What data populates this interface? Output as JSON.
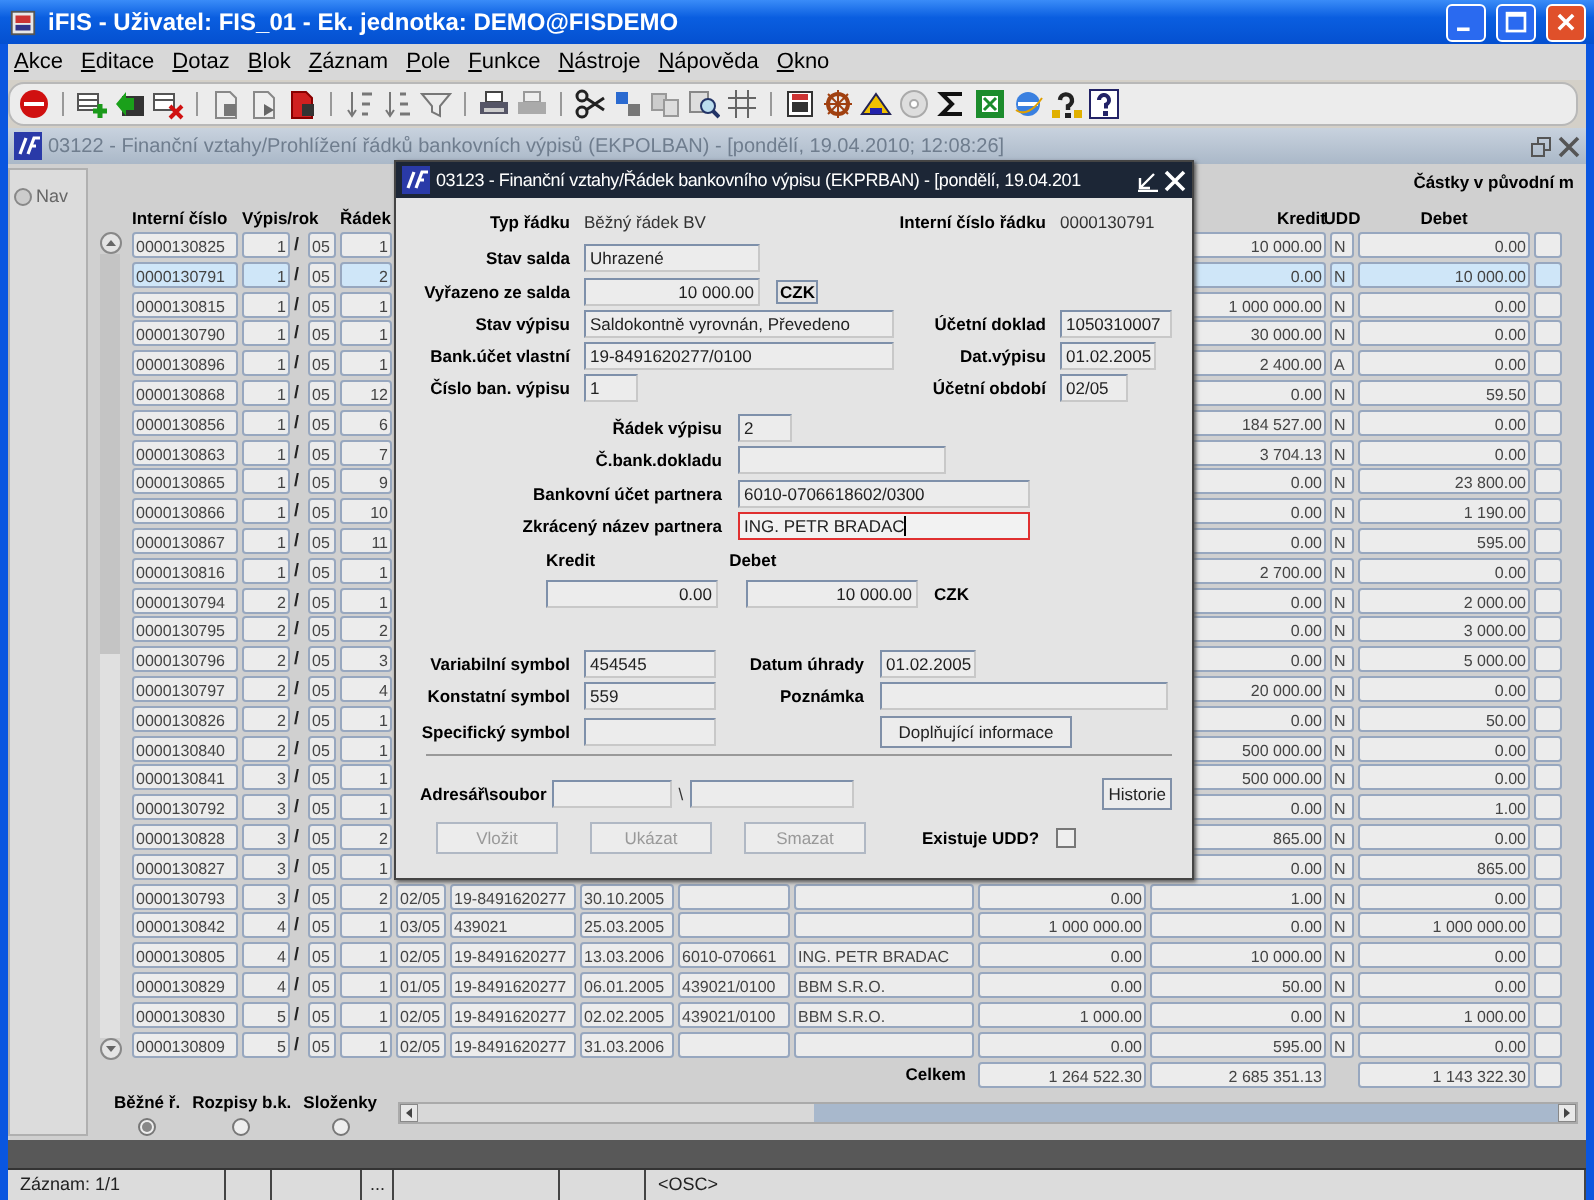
{
  "window": {
    "title": "iFIS - Uživatel: FIS_01 - Ek. jednotka: DEMO@FISDEMO"
  },
  "menu": [
    "Akce",
    "Editace",
    "Dotaz",
    "Blok",
    "Záznam",
    "Pole",
    "Funkce",
    "Nástroje",
    "Nápověda",
    "Okno"
  ],
  "inner_window": {
    "title": "03122 - Finanční vztahy/Prohlížení řádků bankovních výpisů (EKPOLBAN) - [pondělí, 19.04.2010; 12:08:26]",
    "nav_label": "Nav"
  },
  "table": {
    "group_header": "Částky v původní m",
    "columns": {
      "id": "Interní číslo",
      "vypis_rok": "Výpis/rok",
      "radek": "Řádek",
      "kredit": "Kredit",
      "udd": "UDD",
      "debet": "Debet"
    },
    "rows": [
      {
        "id": "0000130825",
        "vypis": "1",
        "sep": "/",
        "rok": "05",
        "radek": "1",
        "kredit": "10 000.00",
        "udd": "N",
        "debet": "0.00",
        "selected": false
      },
      {
        "id": "0000130791",
        "vypis": "1",
        "sep": "/",
        "rok": "05",
        "radek": "2",
        "kredit": "0.00",
        "udd": "N",
        "debet": "10 000.00",
        "selected": true
      },
      {
        "id": "0000130815",
        "vypis": "1",
        "sep": "/",
        "rok": "05",
        "radek": "1",
        "kredit": "1 000 000.00",
        "udd": "N",
        "debet": "0.00",
        "selected": false
      },
      {
        "id": "0000130790",
        "vypis": "1",
        "sep": "/",
        "rok": "05",
        "radek": "1",
        "kredit": "30 000.00",
        "udd": "N",
        "debet": "0.00",
        "selected": false
      },
      {
        "id": "0000130896",
        "vypis": "1",
        "sep": "/",
        "rok": "05",
        "radek": "1",
        "kredit": "2 400.00",
        "udd": "A",
        "debet": "0.00",
        "selected": false
      },
      {
        "id": "0000130868",
        "vypis": "1",
        "sep": "/",
        "rok": "05",
        "radek": "12",
        "kredit": "0.00",
        "udd": "N",
        "debet": "59.50",
        "selected": false
      },
      {
        "id": "0000130856",
        "vypis": "1",
        "sep": "/",
        "rok": "05",
        "radek": "6",
        "kredit": "184 527.00",
        "udd": "N",
        "debet": "0.00",
        "selected": false
      },
      {
        "id": "0000130863",
        "vypis": "1",
        "sep": "/",
        "rok": "05",
        "radek": "7",
        "kredit": "3 704.13",
        "udd": "N",
        "debet": "0.00",
        "selected": false
      },
      {
        "id": "0000130865",
        "vypis": "1",
        "sep": "/",
        "rok": "05",
        "radek": "9",
        "kredit": "0.00",
        "udd": "N",
        "debet": "23 800.00",
        "selected": false
      },
      {
        "id": "0000130866",
        "vypis": "1",
        "sep": "/",
        "rok": "05",
        "radek": "10",
        "kredit": "0.00",
        "udd": "N",
        "debet": "1 190.00",
        "selected": false
      },
      {
        "id": "0000130867",
        "vypis": "1",
        "sep": "/",
        "rok": "05",
        "radek": "11",
        "kredit": "0.00",
        "udd": "N",
        "debet": "595.00",
        "selected": false
      },
      {
        "id": "0000130816",
        "vypis": "1",
        "sep": "/",
        "rok": "05",
        "radek": "1",
        "kredit": "2 700.00",
        "udd": "N",
        "debet": "0.00",
        "selected": false
      },
      {
        "id": "0000130794",
        "vypis": "2",
        "sep": "/",
        "rok": "05",
        "radek": "1",
        "kredit": "0.00",
        "udd": "N",
        "debet": "2 000.00",
        "selected": false
      },
      {
        "id": "0000130795",
        "vypis": "2",
        "sep": "/",
        "rok": "05",
        "radek": "2",
        "kredit": "0.00",
        "udd": "N",
        "debet": "3 000.00",
        "selected": false
      },
      {
        "id": "0000130796",
        "vypis": "2",
        "sep": "/",
        "rok": "05",
        "radek": "3",
        "kredit": "0.00",
        "udd": "N",
        "debet": "5 000.00",
        "selected": false
      },
      {
        "id": "0000130797",
        "vypis": "2",
        "sep": "/",
        "rok": "05",
        "radek": "4",
        "kredit": "20 000.00",
        "udd": "N",
        "debet": "0.00",
        "selected": false
      },
      {
        "id": "0000130826",
        "vypis": "2",
        "sep": "/",
        "rok": "05",
        "radek": "1",
        "kredit": "0.00",
        "udd": "N",
        "debet": "50.00",
        "selected": false
      },
      {
        "id": "0000130840",
        "vypis": "2",
        "sep": "/",
        "rok": "05",
        "radek": "1",
        "kredit": "500 000.00",
        "udd": "N",
        "debet": "0.00",
        "selected": false
      },
      {
        "id": "0000130841",
        "vypis": "3",
        "sep": "/",
        "rok": "05",
        "radek": "1",
        "kredit": "500 000.00",
        "udd": "N",
        "debet": "0.00",
        "selected": false
      },
      {
        "id": "0000130792",
        "vypis": "3",
        "sep": "/",
        "rok": "05",
        "radek": "1",
        "kredit": "0.00",
        "udd": "N",
        "debet": "1.00",
        "selected": false
      },
      {
        "id": "0000130828",
        "vypis": "3",
        "sep": "/",
        "rok": "05",
        "radek": "2",
        "kredit": "865.00",
        "udd": "N",
        "debet": "0.00",
        "selected": false
      },
      {
        "id": "0000130827",
        "vypis": "3",
        "sep": "/",
        "rok": "05",
        "radek": "1",
        "kredit": "0.00",
        "udd": "N",
        "debet": "865.00",
        "selected": false
      },
      {
        "id": "0000130793",
        "vypis": "3",
        "sep": "/",
        "rok": "05",
        "radek": "2",
        "column_6": "02/05",
        "column_7": "19-8491620277",
        "column_8": "30.10.2005",
        "column_11": "0.00",
        "kredit": "1.00",
        "udd": "N",
        "debet": "0.00",
        "selected": false
      },
      {
        "id": "0000130842",
        "vypis": "4",
        "sep": "/",
        "rok": "05",
        "radek": "1",
        "column_6": "03/05",
        "column_7": "439021",
        "column_8": "25.03.2005",
        "column_11": "1 000 000.00",
        "kredit": "0.00",
        "udd": "N",
        "debet": "1 000 000.00",
        "selected": false
      },
      {
        "id": "0000130805",
        "vypis": "4",
        "sep": "/",
        "rok": "05",
        "radek": "1",
        "column_6": "02/05",
        "column_7": "19-8491620277",
        "column_8": "13.03.2006",
        "column_9": "6010-070661",
        "column_10": "ING. PETR BRADAC",
        "column_11": "0.00",
        "kredit": "10 000.00",
        "udd": "N",
        "debet": "0.00",
        "selected": false
      },
      {
        "id": "0000130829",
        "vypis": "4",
        "sep": "/",
        "rok": "05",
        "radek": "1",
        "column_6": "01/05",
        "column_7": "19-8491620277",
        "column_8": "06.01.2005",
        "column_9": "439021/0100",
        "column_10": "BBM S.R.O.",
        "column_11": "0.00",
        "kredit": "50.00",
        "udd": "N",
        "debet": "0.00",
        "selected": false
      },
      {
        "id": "0000130830",
        "vypis": "5",
        "sep": "/",
        "rok": "05",
        "radek": "1",
        "column_6": "02/05",
        "column_7": "19-8491620277",
        "column_8": "02.02.2005",
        "column_9": "439021/0100",
        "column_10": "BBM S.R.O.",
        "column_11": "1 000.00",
        "kredit": "0.00",
        "udd": "N",
        "debet": "1 000.00",
        "selected": false
      },
      {
        "id": "0000130809",
        "vypis": "5",
        "sep": "/",
        "rok": "05",
        "radek": "1",
        "column_6": "02/05",
        "column_7": "19-8491620277",
        "column_8": "31.03.2006",
        "column_11": "0.00",
        "kredit": "595.00",
        "udd": "N",
        "debet": "0.00",
        "selected": false
      }
    ],
    "totals": {
      "label": "Celkem",
      "column_11": "1 264 522.30",
      "kredit": "2 685 351.13",
      "debet": "1 143 322.30"
    }
  },
  "radios": [
    {
      "label": "Běžné ř.",
      "selected": true
    },
    {
      "label": "Rozpisy b.k.",
      "selected": false
    },
    {
      "label": "Složenky",
      "selected": false
    }
  ],
  "dialog": {
    "title": "03123 - Finanční vztahy/Řádek bankovního výpisu (EKPRBAN) - [pondělí, 19.04.201",
    "typ_radku": {
      "label": "Typ řádku",
      "value": "Běžný řádek BV"
    },
    "interni_cislo_radku": {
      "label": "Interní číslo řádku",
      "value": "0000130791"
    },
    "stav_salda": {
      "label": "Stav salda",
      "value": "Uhrazené"
    },
    "vyrazeno_ze_salda": {
      "label": "Vyřazeno ze salda",
      "value": "10 000.00",
      "currency": "CZK"
    },
    "stav_vypisu": {
      "label": "Stav výpisu",
      "value": "Saldokontně vyrovnán, Převedeno"
    },
    "ucetni_doklad": {
      "label": "Účetní doklad",
      "value": "1050310007"
    },
    "bank_ucet_vlastni": {
      "label": "Bank.účet vlastní",
      "value": "19-8491620277/0100"
    },
    "dat_vypisu": {
      "label": "Dat.výpisu",
      "value": "01.02.2005"
    },
    "cislo_ban_vypisu": {
      "label": "Číslo ban. výpisu",
      "value": "1"
    },
    "ucetni_obdobi": {
      "label": "Účetní období",
      "value": "02/05"
    },
    "radek_vypisu": {
      "label": "Řádek výpisu",
      "value": "2"
    },
    "c_bank_dokladu": {
      "label": "Č.bank.dokladu"
    },
    "bankovni_ucet_partnera": {
      "label": "Bankovní účet partnera",
      "value": "6010-0706618602/0300"
    },
    "zkraceny_nazev_partnera": {
      "label": "Zkrácený název partnera",
      "value": "ING. PETR BRADAC",
      "focused": true
    },
    "kredit": {
      "label": "Kredit",
      "value": "0.00"
    },
    "debet": {
      "label": "Debet",
      "value": "10 000.00",
      "currency": "CZK"
    },
    "variabilni_symbol": {
      "label": "Variabilní symbol",
      "value": "454545"
    },
    "datum_uhrady": {
      "label": "Datum úhrady",
      "value": "01.02.2005"
    },
    "konstantni_symbol": {
      "label": "Konstatní symbol",
      "value": "559"
    },
    "poznamka": {
      "label": "Poznámka"
    },
    "specificky_symbol": {
      "label": "Specifický symbol"
    },
    "doplnujici_button": "Doplňující informace",
    "adresar": {
      "label": "Adresář\\soubor",
      "separator": "\\"
    },
    "historie_button": "Historie",
    "buttons": [
      {
        "label": "Vložit",
        "disabled": true
      },
      {
        "label": "Ukázat",
        "disabled": true
      },
      {
        "label": "Smazat",
        "disabled": true
      }
    ],
    "existuje_udd": {
      "label": "Existuje UDD?",
      "checked": false
    }
  },
  "status_bar": {
    "record": "Záznam: 1/1",
    "segment": "...",
    "mode": "<OSC>"
  }
}
